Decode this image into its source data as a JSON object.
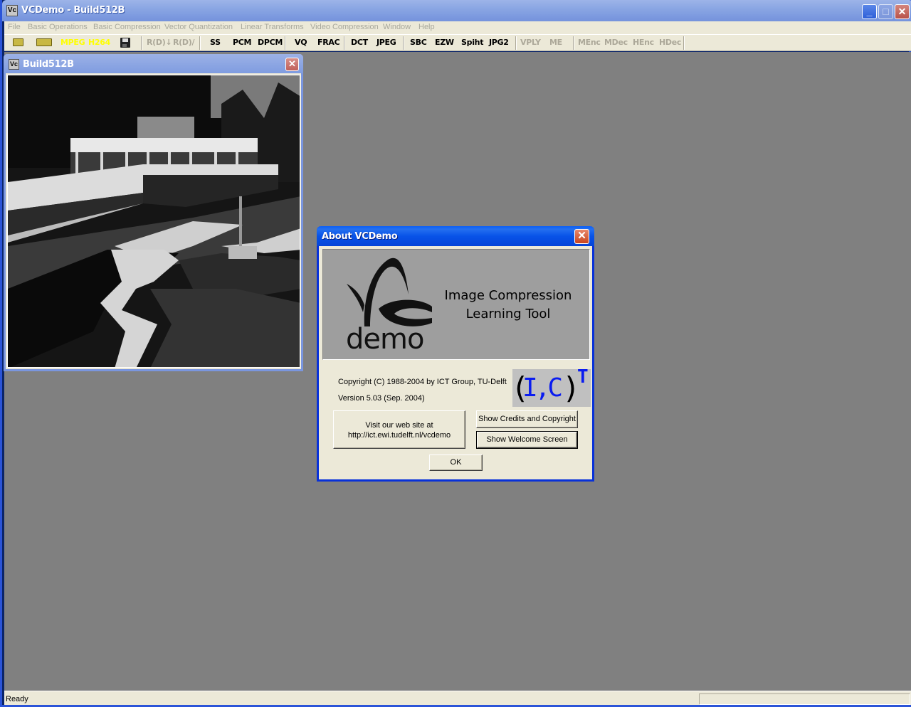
{
  "window": {
    "title": "VCDemo - Build512B",
    "icon": "vcdemo-app-icon",
    "controls": {
      "minimize": "_",
      "maximize": "□",
      "close": "✕"
    }
  },
  "menu": [
    "File",
    "Basic Operations",
    "Basic Compression",
    "Vector Quantization",
    "Linear Transforms",
    "Video Compression",
    "Window",
    "Help"
  ],
  "toolbar": {
    "open_icon": "folder-open-icon",
    "open_multi_icon": "folders-open-icon",
    "mpeg": "MPEG",
    "h264": "H264",
    "save_icon": "floppy-disk-icon",
    "rd_down": "R(D)↓",
    "rd_slope": "R(D)/",
    "ss": "SS",
    "pcm": "PCM",
    "dpcm": "DPCM",
    "vq": "VQ",
    "frac": "FRAC",
    "dct": "DCT",
    "jpeg": "JPEG",
    "sbc": "SBC",
    "ezw": "EZW",
    "spiht": "Spiht",
    "jpg2": "JPG2",
    "vply": "VPLY",
    "me": "ME",
    "menc": "MEnc",
    "mdec": "MDec",
    "henc": "HEnc",
    "hdec": "HDec"
  },
  "child_window": {
    "title": "Build512B",
    "close": "✕",
    "image_description": "Grayscale photo of a modernist building with courtyard garden and ponds"
  },
  "about_dialog": {
    "title": "About VCDemo",
    "close": "✕",
    "logo_text": "demo",
    "tagline_line1": "Image Compression",
    "tagline_line2": "Learning Tool",
    "copyright": "Copyright (C) 1988-2004 by  ICT Group, TU-Delft",
    "version": "Version 5.03 (Sep. 2004)",
    "ict_logo": {
      "open": "(",
      "ic": "I,C",
      "close": ")",
      "sup": "T"
    },
    "website_line1": "Visit our web site at",
    "website_line2": "http://ict.ewi.tudelft.nl/vcdemo",
    "credits_button": "Show Credits and Copyright",
    "welcome_button": "Show Welcome Screen",
    "ok_button": "OK"
  },
  "status": {
    "text": "Ready"
  }
}
